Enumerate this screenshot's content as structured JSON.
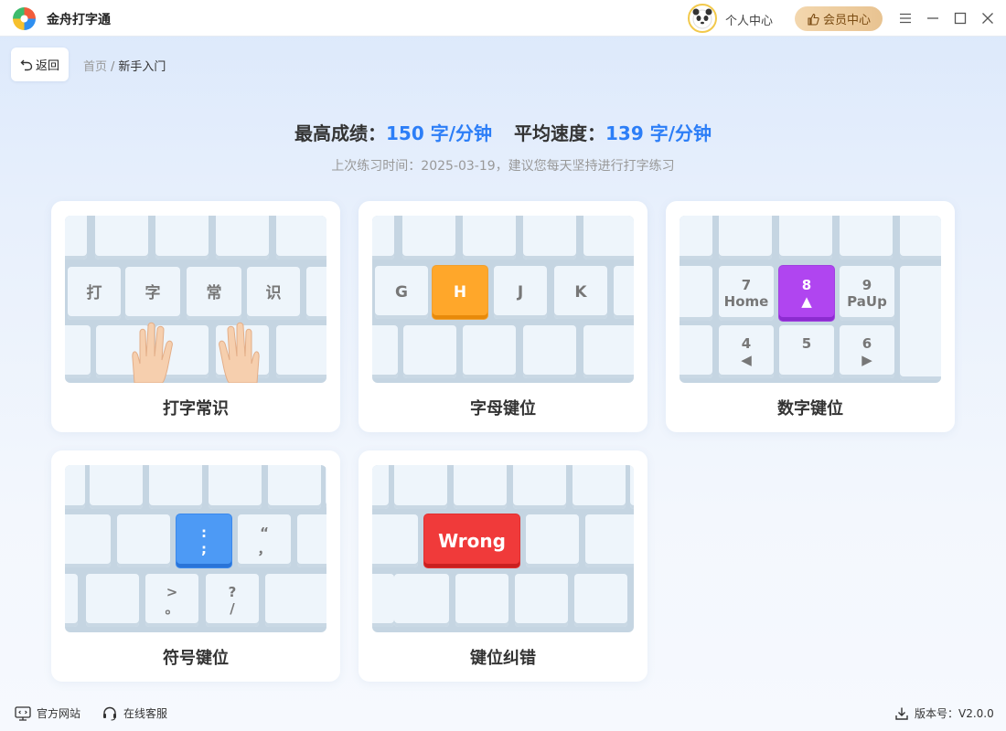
{
  "app": {
    "title": "金舟打字通"
  },
  "header": {
    "personal_label": "个人中心",
    "vip_label": "会员中心"
  },
  "nav": {
    "back_label": "返回",
    "breadcrumb": [
      "首页",
      "新手入门"
    ],
    "separator": "/"
  },
  "stats": {
    "best_label": "最高成绩：",
    "best_value": "150 字/分钟",
    "avg_label": "平均速度：",
    "avg_value": "139 字/分钟",
    "last_practice": "上次练习时间：2025-03-19，建议您每天坚持进行打字练习"
  },
  "cards": [
    {
      "title": "打字常识",
      "keys": [
        "打",
        "字",
        "常",
        "识"
      ]
    },
    {
      "title": "字母键位",
      "keys": [
        "G",
        "H",
        "J",
        "K"
      ],
      "highlight": "H"
    },
    {
      "title": "数字键位",
      "keys": [
        "7",
        "Home",
        "8",
        "▲",
        "9",
        "PaUp",
        "4",
        "◀",
        "5",
        "6",
        "▶"
      ],
      "highlight": "8"
    },
    {
      "title": "符号键位",
      "keys": [
        ":",
        ";",
        "“",
        "，",
        ">",
        "。",
        "?",
        "/"
      ],
      "highlight": ":"
    },
    {
      "title": "键位纠错",
      "keys": [
        "Wrong"
      ],
      "highlight": "Wrong"
    }
  ],
  "colors": {
    "accent": "#2c7ef7",
    "orange": "#ffa72a",
    "purple": "#b045f0",
    "blue": "#4d9af5",
    "red": "#f03a3a"
  },
  "footer": {
    "website_label": "官方网站",
    "service_label": "在线客服",
    "version_label": "版本号：V2.0.0"
  }
}
